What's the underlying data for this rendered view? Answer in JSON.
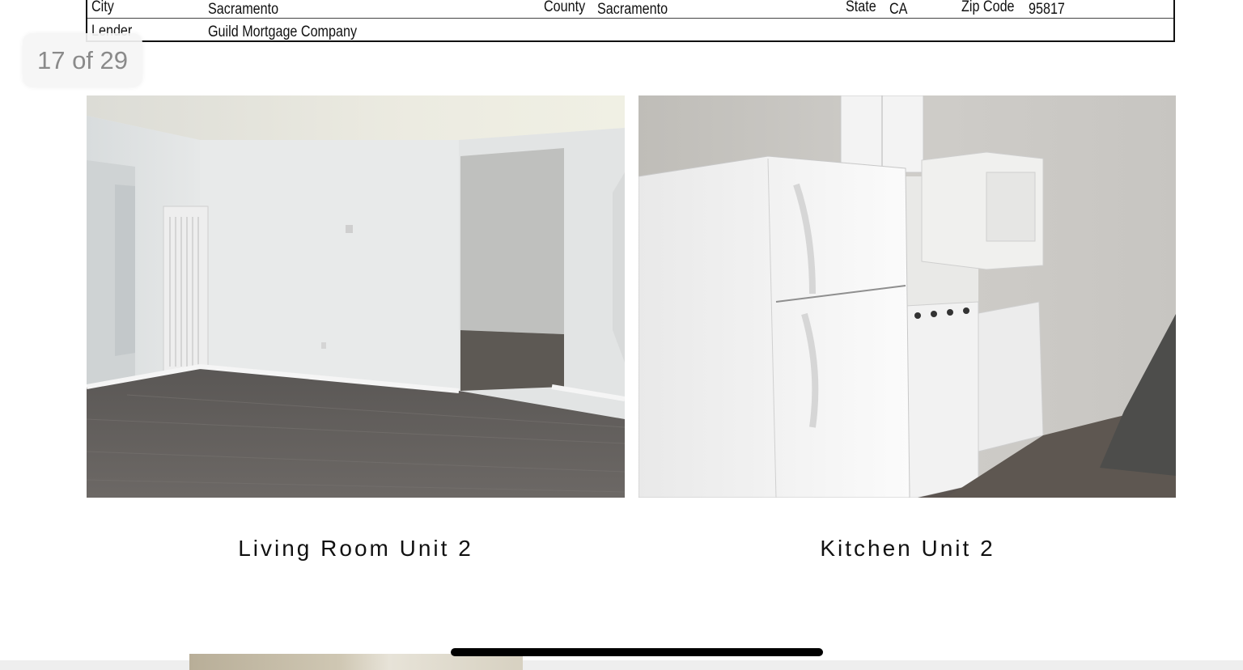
{
  "document": {
    "header_table": {
      "city_label": "City",
      "city_value": "Sacramento",
      "county_label": "County",
      "county_value": "Sacramento",
      "state_label": "State",
      "state_value": "CA",
      "zip_label": "Zip Code",
      "zip_value": "95817",
      "lender_label": "Lender",
      "lender_value": "Guild Mortgage Company"
    },
    "photos": [
      {
        "caption": "Living Room Unit 2"
      },
      {
        "caption": "Kitchen Unit 2"
      }
    ]
  },
  "viewer": {
    "page_counter": "17 of 29"
  },
  "colors": {
    "floor": "#5f5b58",
    "wall": "#e9ebeb",
    "counter_bg": "#f5f5f5",
    "counter_text": "#8a8a8a"
  }
}
